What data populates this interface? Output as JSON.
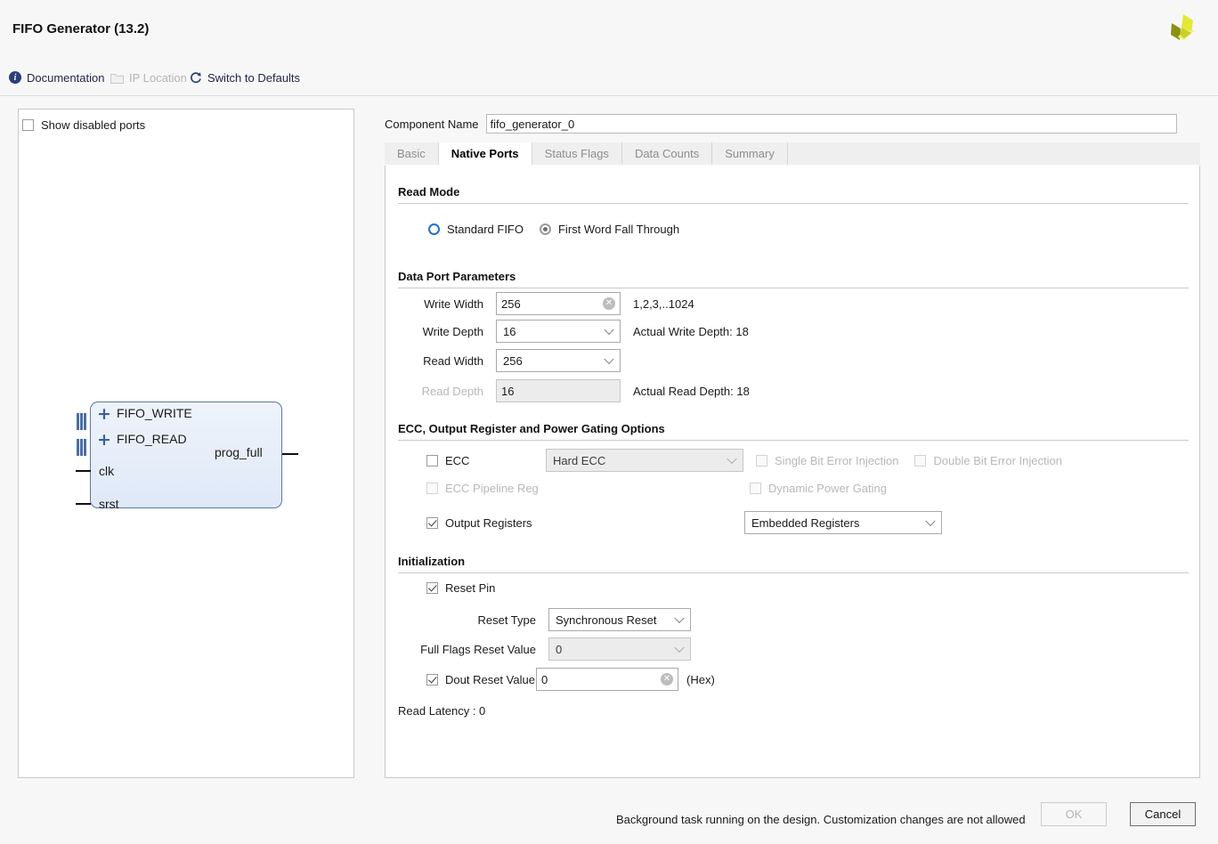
{
  "window": {
    "title": "FIFO Generator (13.2)",
    "logo_icon": "xilinx-pinwheel-logo"
  },
  "toolbar": {
    "documentation": {
      "label": "Documentation",
      "icon": "info-icon",
      "enabled": true
    },
    "ip_location": {
      "label": "IP Location",
      "icon": "folder-icon",
      "enabled": false
    },
    "switch_to_defaults": {
      "label": "Switch to Defaults",
      "icon": "refresh-icon",
      "enabled": true
    }
  },
  "left_panel": {
    "show_disabled_ports": {
      "label": "Show disabled ports",
      "checked": false
    },
    "diagram": {
      "bus_ports": [
        "FIFO_WRITE",
        "FIFO_READ"
      ],
      "input_pins": [
        "clk",
        "srst"
      ],
      "output_pins": [
        "prog_full"
      ],
      "expand_icon": "plus-icon",
      "bus_icon": "bus-connector-icon"
    }
  },
  "component": {
    "label": "Component Name",
    "value": "fifo_generator_0",
    "placeholder": "fifo_generator_0"
  },
  "tabs": [
    {
      "label": "Basic",
      "active": false
    },
    {
      "label": "Native Ports",
      "active": true
    },
    {
      "label": "Status Flags",
      "active": false
    },
    {
      "label": "Data Counts",
      "active": false
    },
    {
      "label": "Summary",
      "active": false
    }
  ],
  "read_mode": {
    "title": "Read Mode",
    "options": [
      {
        "label": "Standard FIFO",
        "selected": false,
        "focused": true
      },
      {
        "label": "First Word Fall Through",
        "selected": true,
        "focused": false
      }
    ]
  },
  "data_port_parameters": {
    "title": "Data Port Parameters",
    "write_width": {
      "label": "Write Width",
      "value": "256",
      "hint": "1,2,3,..1024",
      "clear_icon": "clear-icon"
    },
    "write_depth": {
      "label": "Write Depth",
      "value": "16",
      "hint": "Actual Write Depth: 18"
    },
    "read_width": {
      "label": "Read Width",
      "value": "256",
      "hint": ""
    },
    "read_depth": {
      "label": "Read Depth",
      "value": "16",
      "hint": "Actual Read Depth: 18",
      "enabled": false
    }
  },
  "ecc_options": {
    "title": "ECC, Output Register and Power Gating Options",
    "ecc": {
      "label": "ECC",
      "checked": false,
      "enabled": true
    },
    "ecc_type": {
      "value": "Hard ECC",
      "enabled": false
    },
    "single_bit_error_injection": {
      "label": "Single Bit Error Injection",
      "checked": false,
      "enabled": false
    },
    "double_bit_error_injection": {
      "label": "Double Bit Error Injection",
      "checked": false,
      "enabled": false
    },
    "ecc_pipeline_reg": {
      "label": "ECC Pipeline Reg",
      "checked": false,
      "enabled": false
    },
    "dynamic_power_gating": {
      "label": "Dynamic Power Gating",
      "checked": false,
      "enabled": false
    },
    "output_registers": {
      "label": "Output Registers",
      "checked": true,
      "enabled": true
    },
    "output_register_type": {
      "value": "Embedded Registers",
      "enabled": true
    }
  },
  "initialization": {
    "title": "Initialization",
    "reset_pin": {
      "label": "Reset Pin",
      "checked": true,
      "enabled": true
    },
    "reset_type": {
      "label": "Reset Type",
      "value": "Synchronous Reset",
      "enabled": true
    },
    "full_flags_reset_value": {
      "label": "Full Flags Reset Value",
      "value": "0",
      "enabled": false
    },
    "dout_reset_value": {
      "label": "Dout Reset Value",
      "checked": true,
      "value": "0",
      "suffix": "(Hex)",
      "clear_icon": "clear-icon"
    },
    "read_latency": "Read Latency : 0"
  },
  "footer": {
    "status_message": "Background task running on the design. Customization changes are not allowed",
    "ok_button": {
      "label": "OK",
      "enabled": false
    },
    "cancel_button": {
      "label": "Cancel",
      "enabled": true
    }
  }
}
